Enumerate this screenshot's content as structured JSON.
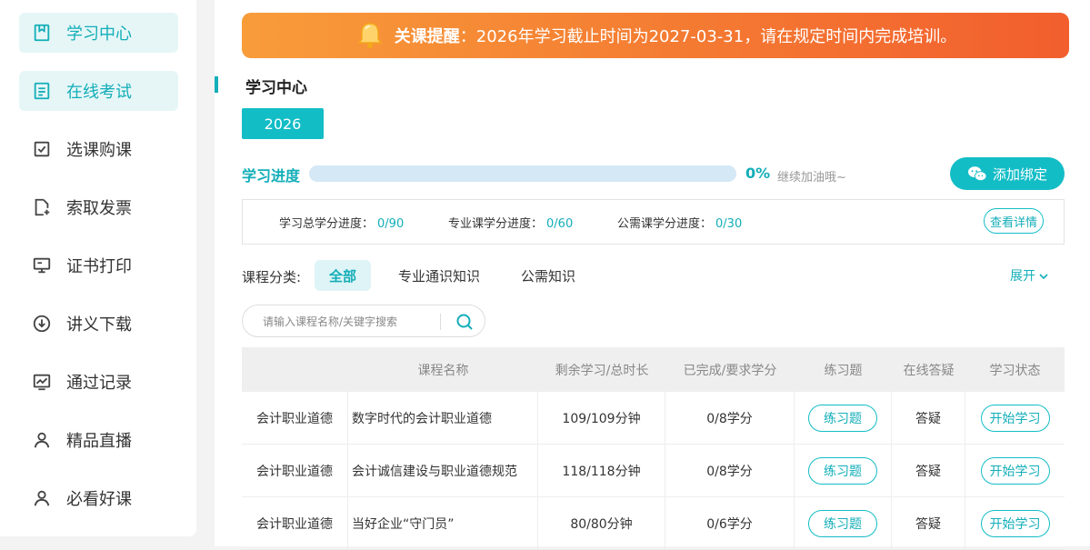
{
  "sidebar": {
    "items": [
      {
        "label": "学习中心",
        "icon": "bookmark-book-icon",
        "active": true
      },
      {
        "label": "在线考试",
        "icon": "exam-list-icon",
        "active": true
      },
      {
        "label": "选课购课",
        "icon": "checkbox-icon",
        "active": false
      },
      {
        "label": "索取发票",
        "icon": "document-add-icon",
        "active": false
      },
      {
        "label": "证书打印",
        "icon": "monitor-icon",
        "active": false
      },
      {
        "label": "讲义下载",
        "icon": "download-circle-icon",
        "active": false
      },
      {
        "label": "通过记录",
        "icon": "chart-record-icon",
        "active": false
      },
      {
        "label": "精品直播",
        "icon": "user-icon",
        "active": false
      },
      {
        "label": "必看好课",
        "icon": "user-icon",
        "active": false
      }
    ]
  },
  "banner": {
    "title": "关课提醒",
    "message": "：2026年学习截止时间为2027-03-31，请在规定时间内完成培训。"
  },
  "page_title": "学习中心",
  "year_tab": "2026",
  "progress": {
    "label": "学习进度",
    "value": 0,
    "percent_text": "0%",
    "tip": "继续加油哦~"
  },
  "bind_button": "添加绑定",
  "credits": {
    "total_label": "学习总学分进度：",
    "total_value": "0/90",
    "major_label": "专业课学分进度：",
    "major_value": "0/60",
    "public_label": "公需课学分进度：",
    "public_value": "0/30",
    "detail_button": "查看详情"
  },
  "categories": {
    "label": "课程分类:",
    "tabs": [
      "全部",
      "专业通识知识",
      "公需知识"
    ],
    "active": "全部",
    "expand": "展开"
  },
  "search": {
    "placeholder": "请输入课程名称/关键字搜索"
  },
  "table": {
    "headers": [
      "",
      "课程名称",
      "剩余学习/总时长",
      "已完成/要求学分",
      "练习题",
      "在线答疑",
      "学习状态"
    ],
    "rows": [
      {
        "category": "会计职业道德",
        "name": "数字时代的会计职业道德",
        "time": "109/109分钟",
        "credits": "0/8学分",
        "exercise": "练习题",
        "qa": "答疑",
        "status": "开始学习"
      },
      {
        "category": "会计职业道德",
        "name": "会计诚信建设与职业道德规范",
        "time": "118/118分钟",
        "credits": "0/8学分",
        "exercise": "练习题",
        "qa": "答疑",
        "status": "开始学习"
      },
      {
        "category": "会计职业道德",
        "name": "当好企业“守门员”",
        "time": "80/80分钟",
        "credits": "0/6学分",
        "exercise": "练习题",
        "qa": "答疑",
        "status": "开始学习"
      }
    ]
  },
  "colors": {
    "accent": "#13bdc6",
    "banner_start": "#f89c3a",
    "banner_end": "#f25e2e"
  }
}
